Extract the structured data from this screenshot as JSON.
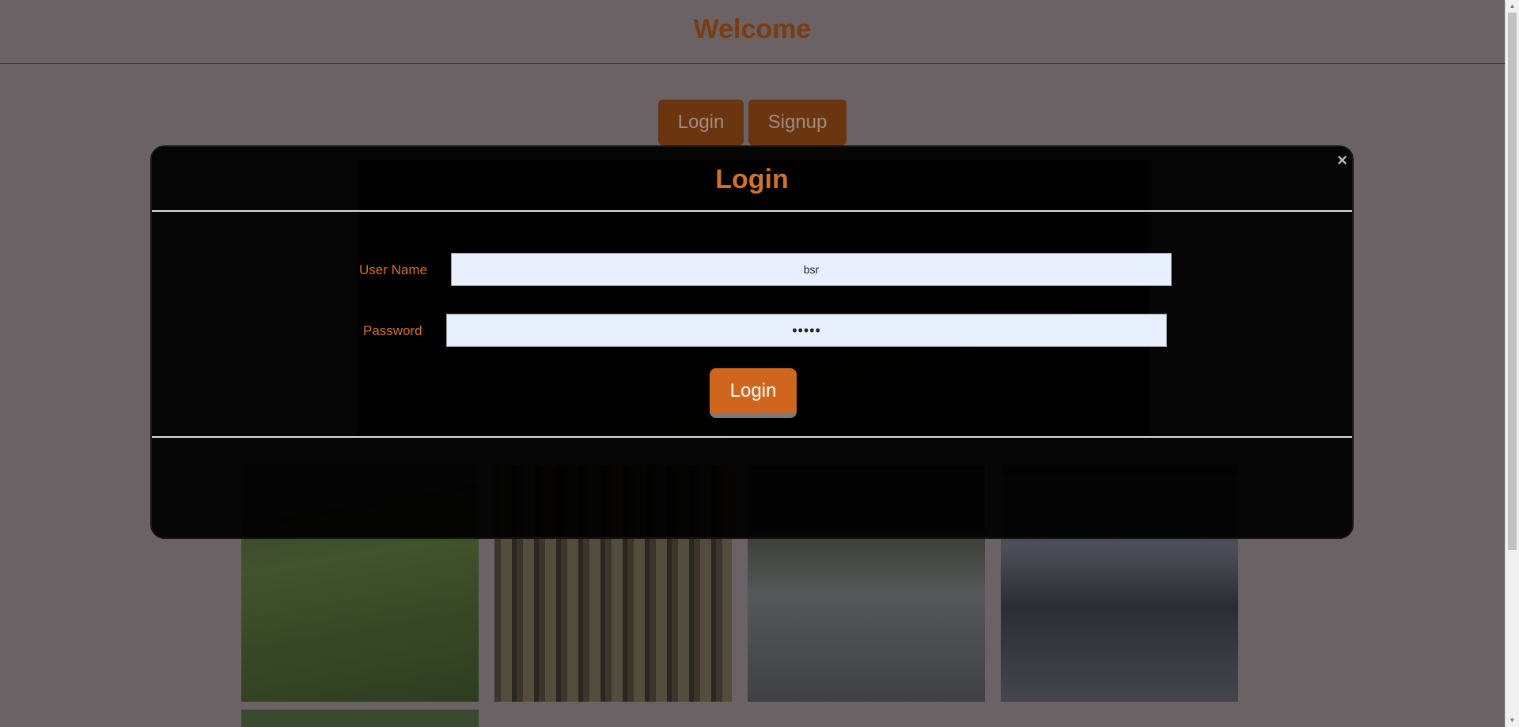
{
  "header": {
    "title": "Welcome"
  },
  "tabs": {
    "login_label": "Login",
    "signup_label": "Signup"
  },
  "carousel": {
    "prev_icon": "chevron-left-icon",
    "next_icon": "chevron-right-icon",
    "prev_glyph": "‹",
    "next_glyph": "›"
  },
  "modal": {
    "title": "Login",
    "close_glyph": "×",
    "username_label": "User Name",
    "username_value": "bsr",
    "password_label": "Password",
    "password_value": "•••••",
    "submit_label": "Login"
  },
  "scrollbar": {
    "up_glyph": "▲",
    "down_glyph": "▼"
  },
  "colors": {
    "accent": "#d0732a",
    "page_background": "#6b6265",
    "modal_background": "#000000",
    "input_background": "#e8f0fe"
  }
}
